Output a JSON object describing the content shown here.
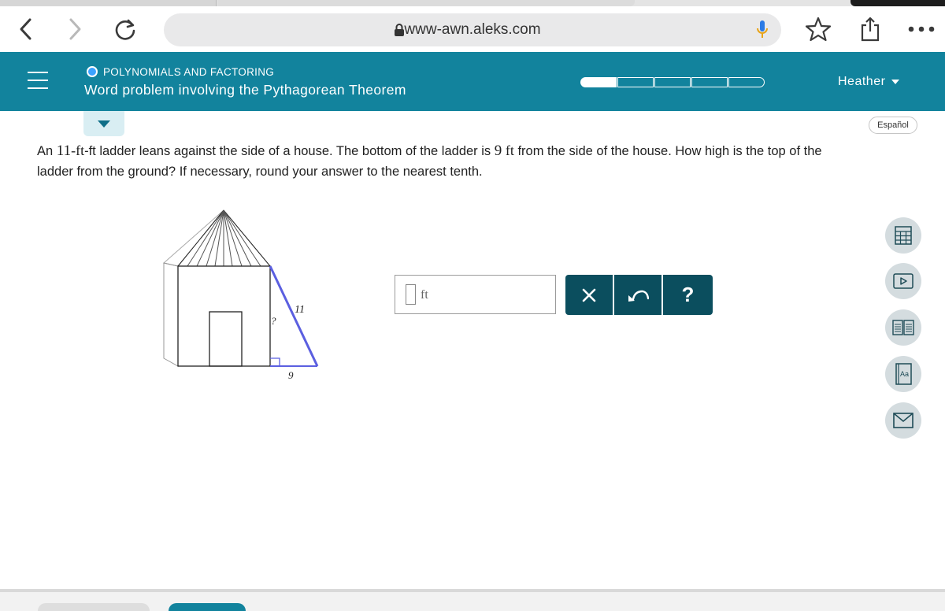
{
  "browser": {
    "url": "www-awn.aleks.com"
  },
  "header": {
    "topic": "POLYNOMIALS AND FACTORING",
    "title": "Word problem involving the Pythagorean Theorem",
    "progress_filled_segments": 1,
    "progress_total_segments": 5,
    "user_name": "Heather"
  },
  "language_button": "Español",
  "question": {
    "part1": "An ",
    "ladder_length": "11",
    "part2": "-ft ladder leans against the side of a house. The bottom of the ladder is ",
    "distance": "9",
    "unit_ft": "ft",
    "part3": " from the side of the house. How high is the top of the ladder from the ground? If necessary, round your answer to the nearest tenth."
  },
  "diagram": {
    "hypotenuse_label": "11",
    "base_label": "9",
    "height_label": "?",
    "ladder_color": "#5b5fe0"
  },
  "answer": {
    "value": "",
    "unit": "ft"
  },
  "actions": {
    "clear": "×",
    "undo": "undo",
    "help": "?"
  },
  "tools": [
    "calculator-icon",
    "video-icon",
    "textbook-icon",
    "dictionary-icon",
    "message-icon"
  ],
  "colors": {
    "header_bg": "#12839d",
    "action_bg": "#0b4e5e"
  }
}
